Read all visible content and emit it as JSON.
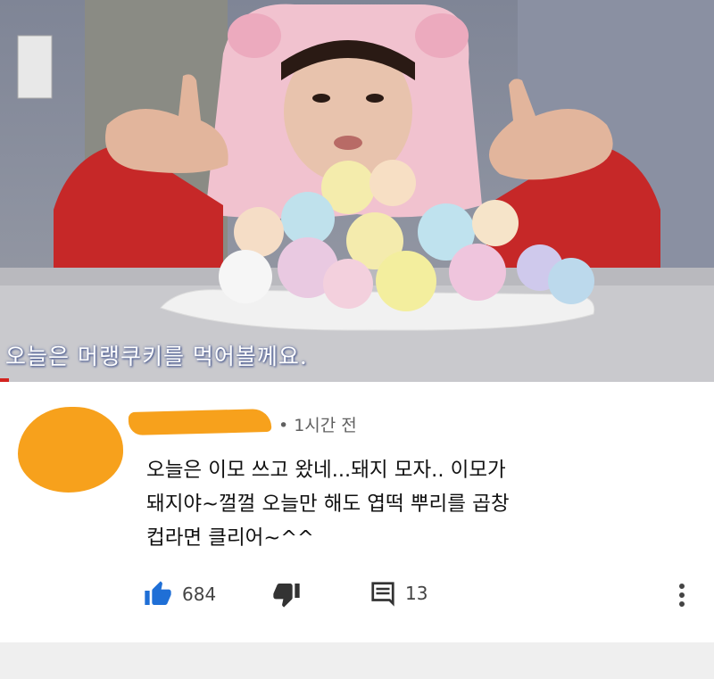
{
  "video": {
    "subtitle": "오늘은 머랭쿠키를 먹어볼께요."
  },
  "comment": {
    "time": "1시간 전",
    "text_lines": [
      "오늘은 이모 쓰고 왔네...돼지 모자.. 이모가",
      "돼지야~껄껄 오늘만 해도 엽떡 뿌리를 곱창",
      "컵라면 클리어~^^"
    ],
    "like_count": "684",
    "reply_count": "13"
  },
  "colors": {
    "redaction": "#f7a11c",
    "like_icon": "#1f6fd6",
    "red_accent": "#d3231f"
  },
  "icons": [
    "thumbs-up-icon",
    "thumbs-down-icon",
    "reply-icon",
    "more-options-icon"
  ]
}
